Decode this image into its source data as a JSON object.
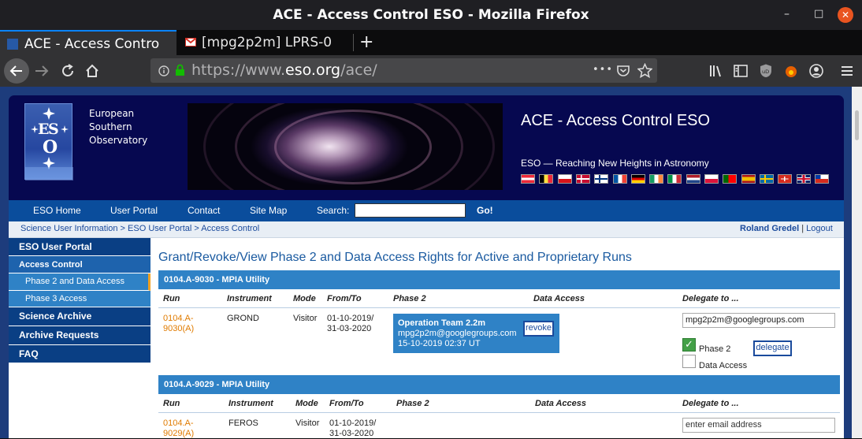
{
  "window": {
    "title": "ACE - Access Control ESO - Mozilla Firefox",
    "minimize": "–",
    "maximize": "□",
    "close": "✕"
  },
  "tabs": [
    {
      "label": "ACE - Access Contro",
      "favicon": "eso-favicon"
    },
    {
      "label": "[mpg2p2m] LPRS-0",
      "favicon": "gmail-icon"
    }
  ],
  "new_tab": "+",
  "url": {
    "prefix": "https://www.",
    "domain": "eso.org",
    "path": "/ace/"
  },
  "toolbar_icons": {
    "more": "•••"
  },
  "header": {
    "org_lines": [
      "European",
      "Southern",
      "Observatory"
    ],
    "title": "ACE - Access Control ESO",
    "subtitle": "ESO — Reaching New Heights in Astronomy"
  },
  "flags": [
    "AT",
    "BE",
    "CZ",
    "DK",
    "FI",
    "FR",
    "DE",
    "IE",
    "IT",
    "NL",
    "PL",
    "PT",
    "ES",
    "SE",
    "CH",
    "GB",
    "CL"
  ],
  "menu": {
    "home": "ESO Home",
    "portal": "User Portal",
    "contact": "Contact",
    "sitemap": "Site Map",
    "search_label": "Search:",
    "go": "Go!"
  },
  "breadcrumb": "Science User Information > ESO User Portal > Access Control",
  "user": {
    "name": "Roland Gredel",
    "sep": " | ",
    "logout": "Logout"
  },
  "sidebar": {
    "portal": "ESO User Portal",
    "access": "Access Control",
    "phase2": "Phase 2 and Data Access",
    "phase3": "Phase 3 Access",
    "archive": "Science Archive",
    "requests": "Archive Requests",
    "faq": "FAQ"
  },
  "main_title": "Grant/Revoke/View Phase 2 and Data Access Rights for Active and Proprietary Runs",
  "columns": {
    "run": "Run",
    "instrument": "Instrument",
    "mode": "Mode",
    "fromto": "From/To",
    "phase2": "Phase 2",
    "data": "Data Access",
    "delegate": "Delegate to ..."
  },
  "projects": [
    {
      "title": "0104.A-9030 - MPIA Utility",
      "run_a": "0104.A-",
      "run_b": "9030(A)",
      "instrument": "GROND",
      "mode": "Visitor",
      "from": "01-10-2019/",
      "to": "31-03-2020",
      "op_team": "Operation Team 2.2m",
      "op_email": "mpg2p2m@googlegroups.com",
      "op_date": "15-10-2019 02:37 UT",
      "revoke": "revoke",
      "delegate_value": "mpg2p2m@googlegroups.com",
      "phase2_label": "Phase 2",
      "data_label": "Data Access",
      "delegate_btn": "delegate"
    },
    {
      "title": "0104.A-9029 - MPIA Utility",
      "run_a": "0104.A-",
      "run_b": "9029(A)",
      "instrument": "FEROS",
      "mode": "Visitor",
      "from": "01-10-2019/",
      "to": "31-03-2020",
      "delegate_placeholder": "enter email address"
    }
  ],
  "colors": {
    "accent": "#2f82c6",
    "navy": "#0a3f84",
    "link_orange": "#e07b00",
    "banner": "#060850"
  }
}
